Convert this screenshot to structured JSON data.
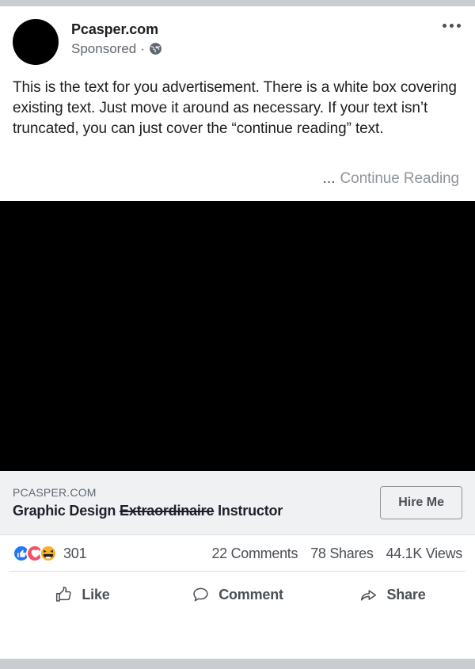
{
  "post": {
    "page_name": "Pcasper.com",
    "sponsored_label": "Sponsored",
    "separator": "·",
    "audience_icon": "globe-icon",
    "menu_icon": "more-options-icon",
    "body_text": "This is the text for you advertisement. There is a white box covering existing text. Just move it around as necessary. If your text isn’t truncated, you can just cover the “continue reading” text.",
    "ellipsis": "...",
    "continue_reading_label": "Continue Reading"
  },
  "link_preview": {
    "domain": "PCASPER.COM",
    "title_part1": "Graphic Design ",
    "title_struck": "Extraordinaire",
    "title_part2": " Instructor",
    "cta_label": "Hire Me"
  },
  "stats": {
    "reactions": [
      {
        "name": "like-reaction-icon",
        "color": "#2078f4"
      },
      {
        "name": "love-reaction-icon",
        "color": "#f25268"
      },
      {
        "name": "haha-reaction-icon",
        "color": "#f7b125"
      }
    ],
    "reaction_count": "301",
    "comments": "22 Comments",
    "shares": "78 Shares",
    "views": "44.1K Views"
  },
  "actions": {
    "like_label": "Like",
    "comment_label": "Comment",
    "share_label": "Share"
  },
  "colors": {
    "background": "#c9ccd1",
    "card": "#ffffff",
    "media": "#000000",
    "link_preview_bg": "#eff1f3",
    "muted_text": "#4b4f56",
    "continue_text": "#90949c"
  }
}
